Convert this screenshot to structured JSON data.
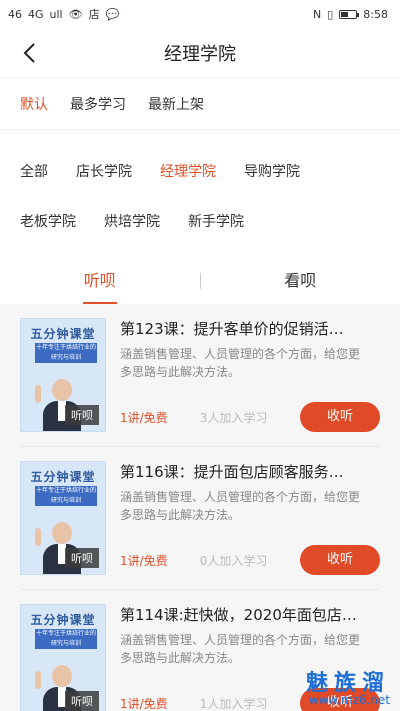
{
  "status": {
    "left": [
      "46",
      "4G",
      "ull",
      "👁",
      "店",
      "💬"
    ],
    "time": "8:58"
  },
  "nav": {
    "title": "经理学院"
  },
  "sort": {
    "items": [
      "默认",
      "最多学习",
      "最新上架"
    ]
  },
  "categories": {
    "row1": [
      "全部",
      "店长学院",
      "经理学院",
      "导购学院"
    ],
    "row2": [
      "老板学院",
      "烘培学院",
      "新手学院"
    ]
  },
  "tabs": {
    "listen": "听呗",
    "watch": "看呗"
  },
  "courses": [
    {
      "title": "第123课：提升客单价的促销活…",
      "desc": "涵盖销售管理、人员管理的各个方面，给您更多思路与此解决方法。",
      "price": "1讲/免费",
      "learners": "3人加入学习",
      "button": "收听",
      "thumb_title": "五分钟课堂",
      "thumb_sub": "十年专注于烘焙行业的研究与培训",
      "thumb_tag": "听呗"
    },
    {
      "title": "第116课：提升面包店顾客服务…",
      "desc": "涵盖销售管理、人员管理的各个方面，给您更多思路与此解决方法。",
      "price": "1讲/免费",
      "learners": "0人加入学习",
      "button": "收听",
      "thumb_title": "五分钟课堂",
      "thumb_sub": "十年专注于烘焙行业的研究与培训",
      "thumb_tag": "听呗"
    },
    {
      "title": "第114课:赶快做，2020年面包店…",
      "desc": "涵盖销售管理、人员管理的各个方面，给您更多思路与此解决方法。",
      "price": "1讲/免费",
      "learners": "1人加入学习",
      "button": "收听",
      "thumb_title": "五分钟课堂",
      "thumb_sub": "十年专注于烘焙行业的研究与培训",
      "thumb_tag": "听呗"
    }
  ],
  "watermark": {
    "main": "魅族溜",
    "url": "www.mz6.net"
  },
  "colors": {
    "accent": "#e0502a",
    "button": "#e04a27"
  }
}
